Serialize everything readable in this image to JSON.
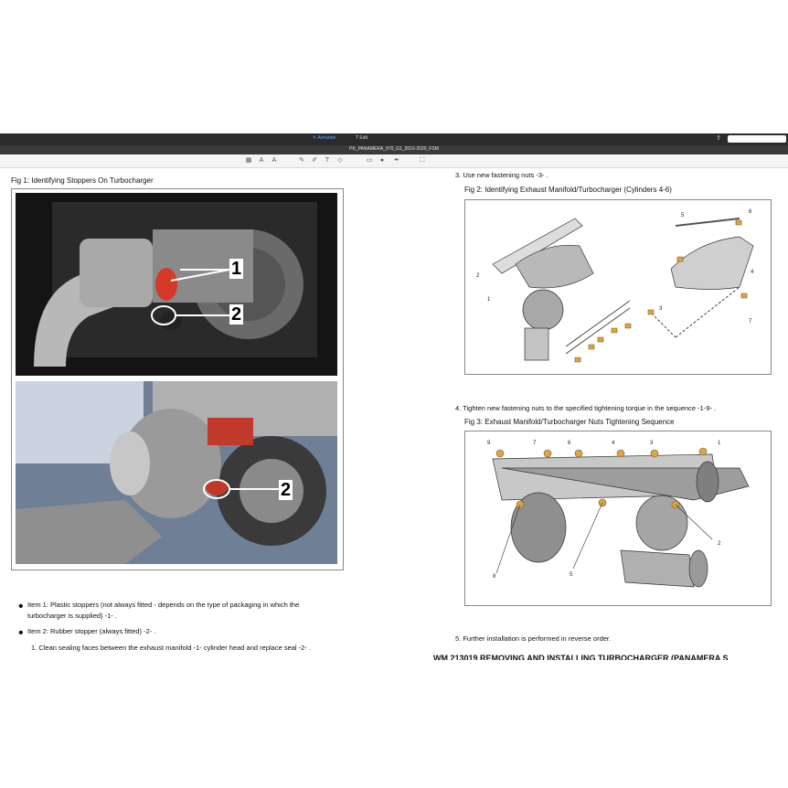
{
  "toolbar": {
    "annotate_label": "Annotate",
    "edit_label": "Edit",
    "file_name": "PK_PANAMERA_970_G1_2016-2020_FSM"
  },
  "left": {
    "fig1_title": "Fig 1: Identifying Stoppers On Turbocharger",
    "photo_callouts": {
      "c1": "1",
      "c2": "2",
      "c3": "2"
    },
    "item1": "Item 1:  Plastic stoppers (not always fitted - depends on the type of packaging in which the turbocharger is supplied) -1- .",
    "item2": "Item 2:  Rubber stopper (always fitted) -2- .",
    "step1": "1. Clean sealing faces between the exhaust manifold -1-  cylinder head and replace seal -2- ."
  },
  "right": {
    "step3": "3.  Use new fastening nuts -3- .",
    "fig2_title": "Fig 2: Identifying Exhaust Manifold/Turbocharger (Cylinders 4-6)",
    "fig2_labels": [
      "1",
      "2",
      "3",
      "4",
      "5",
      "6",
      "7"
    ],
    "step4": "4.  Tighten new fastening nuts to the specified tightening torque in the sequence -1-9- .",
    "fig3_title": "Fig 3: Exhaust Manifold/Turbocharger Nuts Tightening Sequence",
    "fig3_top_labels": [
      "9",
      "7",
      "6",
      "4",
      "3",
      "1"
    ],
    "fig3_other_labels": [
      "2",
      "5",
      "8"
    ],
    "step5": "5. Further installation is performed in reverse order.",
    "next_section": "WM 213019 REMOVING AND INSTALLING TURBOCHARGER (PANAMERA S"
  },
  "colors": {
    "toolbar_bg": "#2b2b2b",
    "accent": "#5aa9ff",
    "nut": "#d9a54a"
  }
}
